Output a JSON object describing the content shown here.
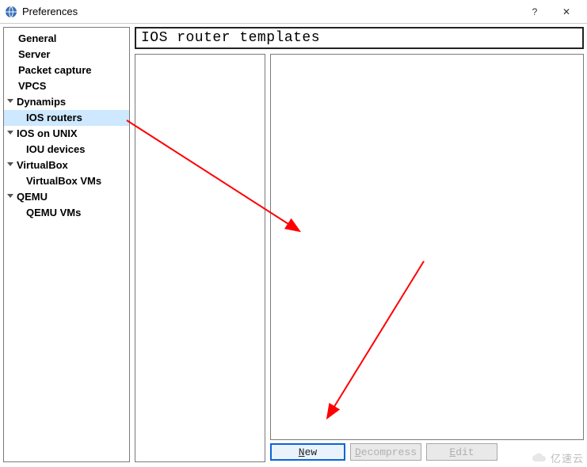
{
  "window": {
    "title": "Preferences",
    "help": "?",
    "close": "✕"
  },
  "sidebar": {
    "items": [
      {
        "label": "General",
        "type": "leaf"
      },
      {
        "label": "Server",
        "type": "leaf"
      },
      {
        "label": "Packet capture",
        "type": "leaf"
      },
      {
        "label": "VPCS",
        "type": "leaf"
      },
      {
        "label": "Dynamips",
        "type": "parent"
      },
      {
        "label": "IOS routers",
        "type": "child",
        "selected": true
      },
      {
        "label": "IOS on UNIX",
        "type": "parent"
      },
      {
        "label": "IOU devices",
        "type": "child"
      },
      {
        "label": "VirtualBox",
        "type": "parent"
      },
      {
        "label": "VirtualBox VMs",
        "type": "child"
      },
      {
        "label": "QEMU",
        "type": "parent"
      },
      {
        "label": "QEMU VMs",
        "type": "child"
      }
    ]
  },
  "main": {
    "title": "IOS router templates",
    "buttons": {
      "new": "New",
      "decompress": "Decompress",
      "edit": "Edit"
    }
  },
  "watermark": "亿速云"
}
